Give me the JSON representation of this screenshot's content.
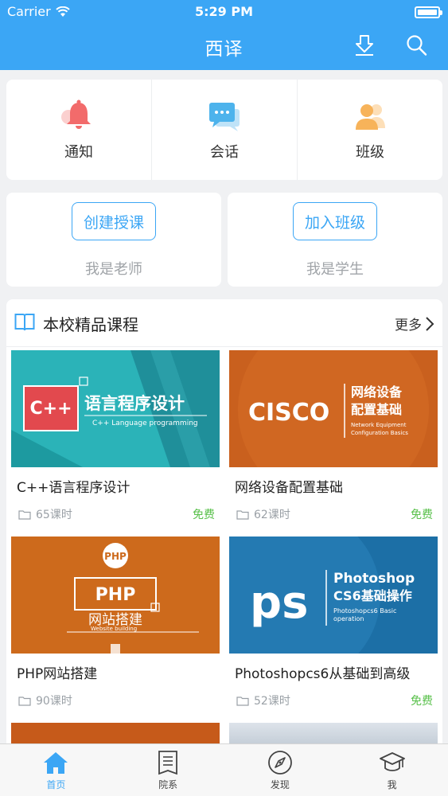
{
  "status": {
    "carrier": "Carrier",
    "time": "5:29 PM"
  },
  "nav": {
    "title": "西译"
  },
  "quick_menu": [
    {
      "label": "通知",
      "icon": "bell-icon"
    },
    {
      "label": "会话",
      "icon": "chat-icon"
    },
    {
      "label": "班级",
      "icon": "class-icon"
    }
  ],
  "roles": {
    "teacher": {
      "button": "创建授课",
      "subtitle": "我是老师"
    },
    "student": {
      "button": "加入班级",
      "subtitle": "我是学生"
    }
  },
  "courses_section": {
    "title": "本校精品课程",
    "more": "更多",
    "items": [
      {
        "name": "C++语言程序设计",
        "hours": "65课时",
        "price": "免费",
        "thumb": {
          "badge": "C++",
          "title": "语言程序设计",
          "subtitle": "C++ Language programming"
        }
      },
      {
        "name": "网络设备配置基础",
        "hours": "62课时",
        "price": "免费",
        "thumb": {
          "badge": "CISCO",
          "title_line1": "网络设备",
          "title_line2": "配置基础",
          "subtitle_line1": "Network Equipment",
          "subtitle_line2": "Configuration Basics"
        }
      },
      {
        "name": "PHP网站搭建",
        "hours": "90课时",
        "price": "",
        "thumb": {
          "badge": "PHP",
          "title": "PHP",
          "subtitle": "网站搭建",
          "caption": "Website building"
        }
      },
      {
        "name": "Photoshopcs6从基础到高级",
        "hours": "52课时",
        "price": "免费",
        "thumb": {
          "badge": "ps",
          "title_line1": "Photoshop",
          "title_line2": "CS6基础操作",
          "subtitle_line1": "Photoshopcs6 Basic",
          "subtitle_line2": "operation"
        }
      }
    ]
  },
  "tabbar": [
    {
      "label": "首页",
      "icon": "home-icon",
      "active": true
    },
    {
      "label": "院系",
      "icon": "department-icon",
      "active": false
    },
    {
      "label": "发现",
      "icon": "compass-icon",
      "active": false
    },
    {
      "label": "我",
      "icon": "graduation-cap-icon",
      "active": false
    }
  ],
  "colors": {
    "accent": "#3ba6f5",
    "free": "#58c04a",
    "background": "#f0f1f3"
  }
}
